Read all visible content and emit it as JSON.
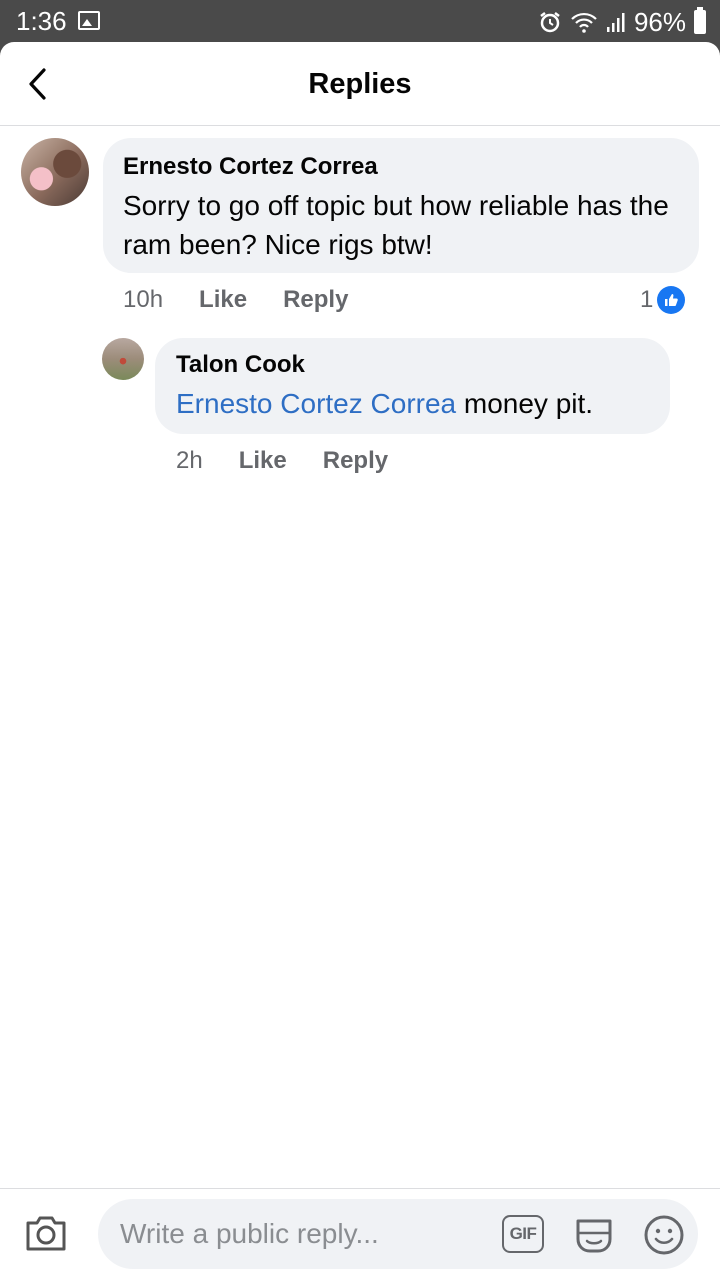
{
  "status_bar": {
    "time": "1:36",
    "battery": "96%"
  },
  "header": {
    "title": "Replies"
  },
  "comment": {
    "author": "Ernesto Cortez Correa",
    "text": "Sorry to go off topic but how reliable has the ram been? Nice rigs btw!",
    "time": "10h",
    "like_label": "Like",
    "reply_label": "Reply",
    "reaction_count": "1"
  },
  "reply": {
    "author": "Talon Cook",
    "mention": "Ernesto Cortez Correa",
    "text": " money pit.",
    "time": "2h",
    "like_label": "Like",
    "reply_label": "Reply"
  },
  "composer": {
    "placeholder": "Write a public reply...",
    "gif_label": "GIF"
  },
  "colors": {
    "accent": "#1877f2",
    "mention": "#2e6ec4",
    "bubble": "#f0f2f5",
    "secondary_text": "#65676b"
  },
  "icons": [
    "gallery-icon",
    "alarm-icon",
    "wifi-icon",
    "signal-icon",
    "battery-icon",
    "back-arrow-icon",
    "like-reaction-icon",
    "camera-icon",
    "gif-icon",
    "sticker-icon",
    "emoji-icon"
  ]
}
